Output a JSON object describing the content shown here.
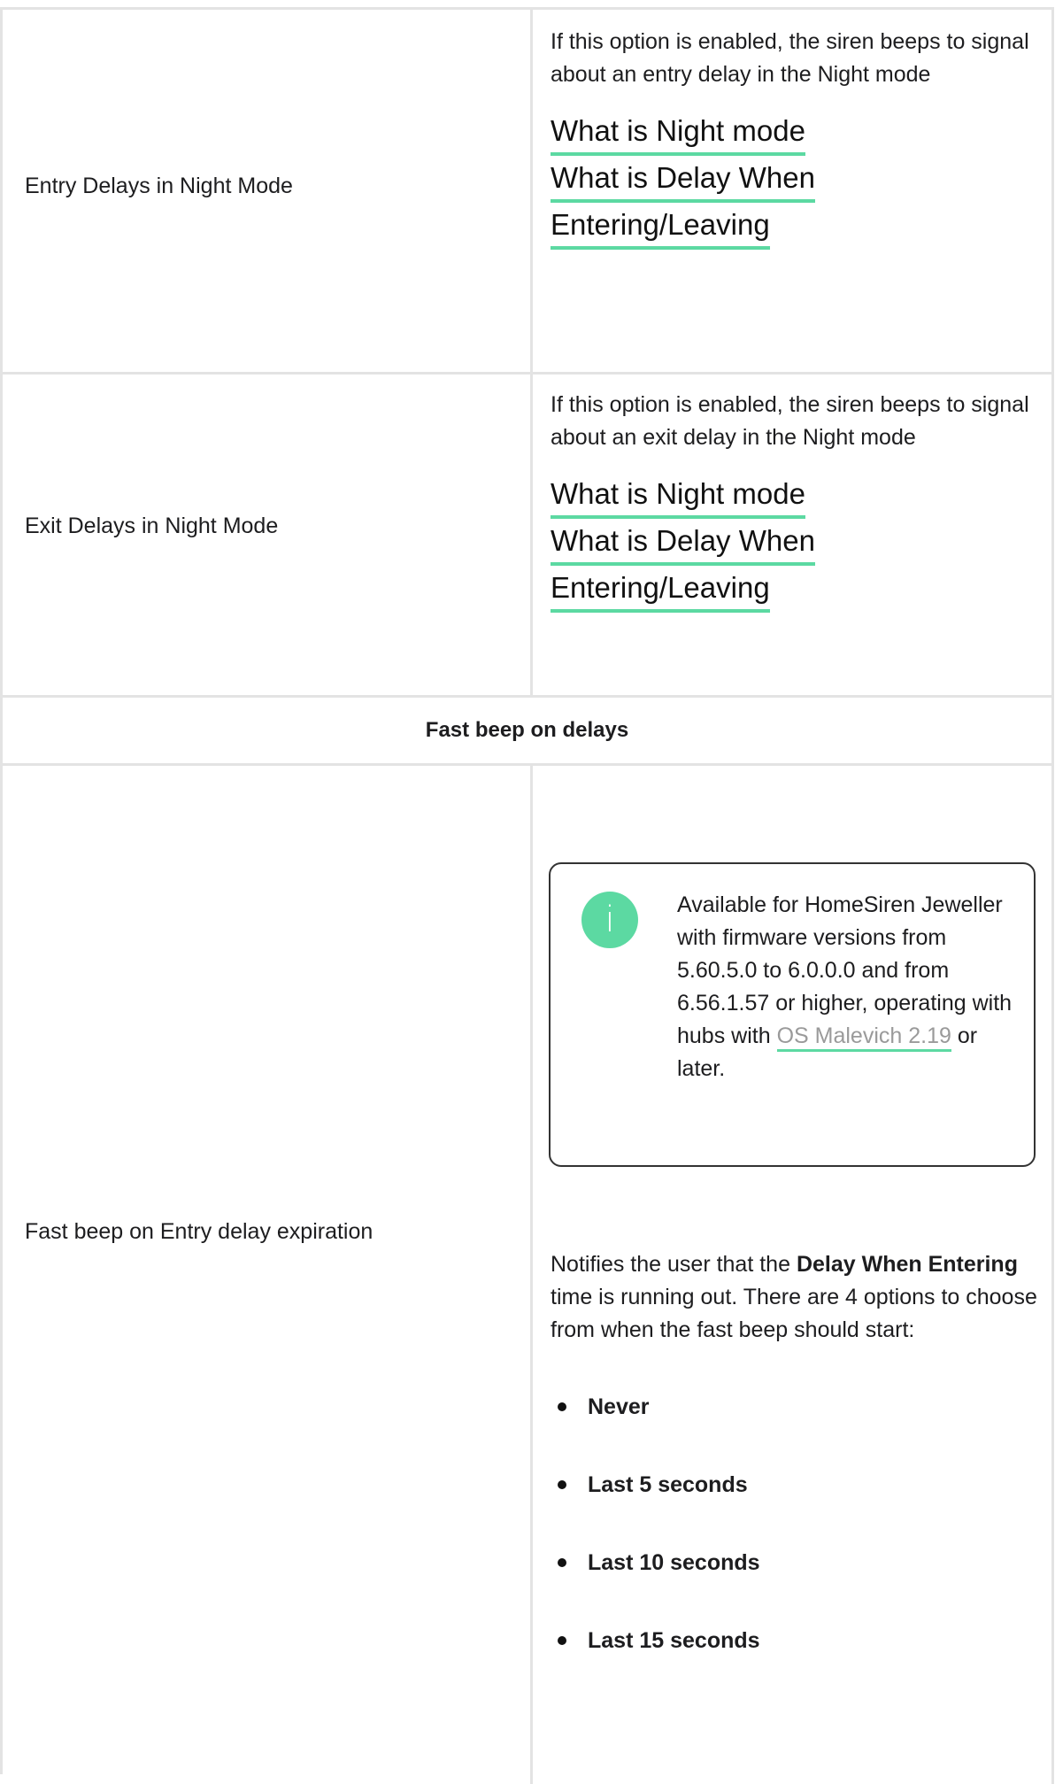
{
  "rows": [
    {
      "label": "Entry Delays in Night Mode",
      "description": "If this option is enabled, the siren beeps to signal about an entry delay in the Night mode",
      "links": [
        "What is Night mode",
        "What is Delay When",
        "Entering/Leaving"
      ]
    },
    {
      "label": "Exit Delays in Night Mode",
      "description": "If this option is enabled, the siren beeps to signal about an exit delay in the Night mode",
      "links": [
        "What is Night mode",
        "What is Delay When",
        "Entering/Leaving"
      ]
    }
  ],
  "section_header": "Fast beep on delays",
  "fast_beep": {
    "label": "Fast beep on Entry delay expiration",
    "info": {
      "icon": "info-icon",
      "text_before": "Available for HomeSiren Jeweller with firmware versions from 5.60.5.0 to 6.0.0.0 and from 6.56.1.57 or higher, operating with hubs with ",
      "link": "OS Malevich 2.19",
      "text_after": " or later."
    },
    "desc_before": "Notifies the user that the ",
    "desc_bold": "Delay When Entering",
    "desc_after": " time is running out. There are 4 options to choose from when the fast beep should start:",
    "options": [
      "Never",
      "Last 5 seconds",
      "Last 10 seconds",
      "Last 15 seconds"
    ]
  },
  "colors": {
    "accent": "#5cd9a2",
    "border": "#e3e3e3"
  }
}
